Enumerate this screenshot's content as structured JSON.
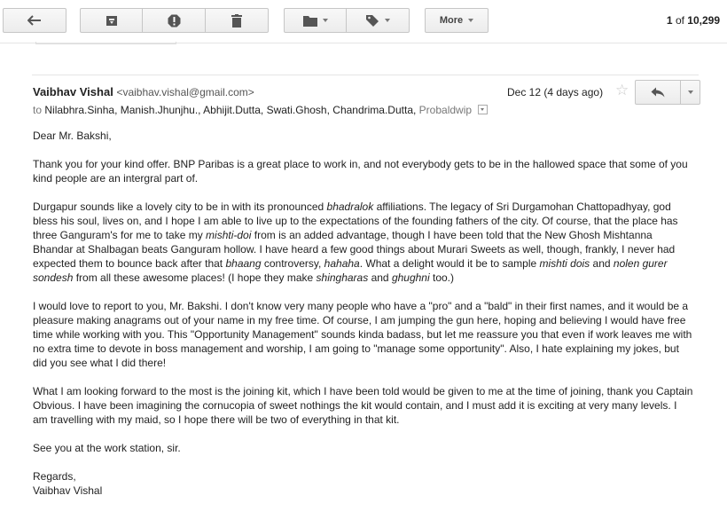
{
  "toolbar": {
    "more_label": "More",
    "pager": {
      "current": "1",
      "of_text": "of",
      "total": "10,299"
    }
  },
  "icons": {
    "back": "back-arrow-icon",
    "archive": "archive-icon",
    "spam": "report-spam-icon",
    "delete": "trash-icon",
    "move": "folder-icon",
    "labels": "label-tag-icon",
    "star": "star-icon",
    "reply": "reply-icon",
    "more_actions": "chevron-down-icon"
  },
  "message": {
    "sender_name": "Vaibhav Vishal",
    "sender_email": "<vaibhav.vishal@gmail.com>",
    "date": "Dec 12 (4 days ago)",
    "to_label": "to",
    "recipients": [
      "Nilabhra.Sinha,",
      "Manish.Jhunjhu.,",
      "Abhijit.Dutta,",
      "Swati.Ghosh,",
      "Chandrima.Dutta,"
    ],
    "recipient_more": "Probaldwip",
    "greeting": "Dear Mr. Bakshi,",
    "p1": "Thank you for your kind offer. BNP Paribas is a great place to work in, and not everybody gets to be in the hallowed space that some of you kind people are an intergral part of.",
    "p2": {
      "a": "Durgapur sounds like a lovely city to be in with its pronounced ",
      "a_it": "bhadralok",
      "b": " affiliations. The legacy of Sri Durgamohan Chattopadhyay, god bless his soul, lives on, and I hope I am able to live up to the expectations of the founding fathers of the city. Of course, that the place has three Ganguram's for me to take my ",
      "b_it": "mishti-doi",
      "c": " from is an added advantage, though I have been told that the New Ghosh Mishtanna Bhandar at Shalbagan beats Ganguram hollow. I have heard a few good things about Murari Sweets as well, though, frankly, I never had expected them to bounce back after that ",
      "c_it": "bhaang",
      "d": " controversy, ",
      "d_it": "hahaha",
      "e": ". What a delight would it be to sample ",
      "e_it": "mishti dois",
      "f": " and ",
      "f_it": "nolen gurer sondesh",
      "g": " from all these awesome places! (I hope they make ",
      "g_it": "shingharas",
      "h": " and ",
      "h_it": "ghughni",
      "i": " too.)"
    },
    "p3": "I would love to report to you, Mr. Bakshi. I don't know very many people who have a \"pro\" and a \"bald\" in their first names, and it would be a pleasure making anagrams out of your name in my free time. Of course, I am jumping the gun here, hoping and believing I would have free time while working with you. This \"Opportunity Management\" sounds kinda badass, but let me reassure you that even if work leaves me with no extra time to devote in boss management and worship, I am going to \"manage some opportunity\". Also, I hate explaining my jokes, but did you see what I did there!",
    "p4": "What I am looking forward to the most is the joining kit, which I have been told would be given to me at the time of joining, thank you Captain Obvious. I have been imagining the cornucopia of sweet nothings the kit would contain, and I must add it is exciting at very many levels. I am travelling with my maid, so I hope there will be two of everything in that kit.",
    "p5": "See you at the work station, sir.",
    "signoff": "Regards,",
    "signature": "Vaibhav Vishal"
  }
}
